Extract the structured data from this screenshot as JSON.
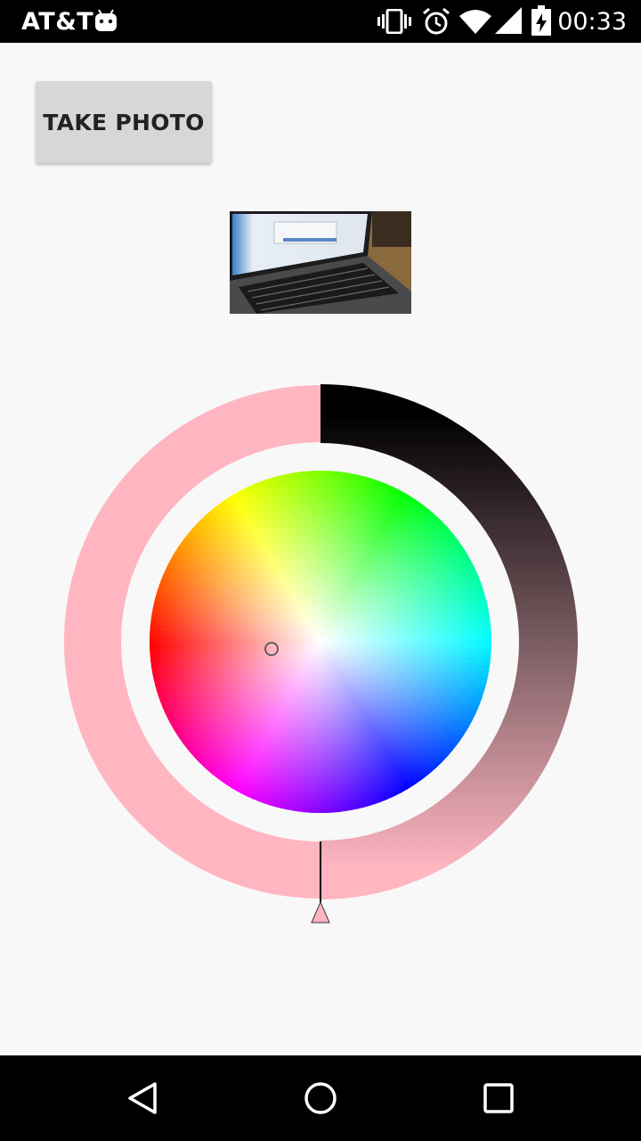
{
  "status_bar": {
    "carrier": "AT&T",
    "time": "00:33",
    "icons": [
      "android-icon",
      "vibrate-icon",
      "alarm-icon",
      "wifi-icon",
      "signal-icon",
      "battery-charging-icon"
    ]
  },
  "main": {
    "take_photo_label": "TAKE PHOTO",
    "thumbnail": "laptop-photo-thumbnail",
    "color_picker": {
      "selected_color": "#ffb6c1",
      "value_ring_dark": "#000000",
      "indicator": "color-selector-circle"
    }
  },
  "nav_bar": {
    "buttons": [
      "back-icon",
      "home-icon",
      "recents-icon"
    ]
  }
}
